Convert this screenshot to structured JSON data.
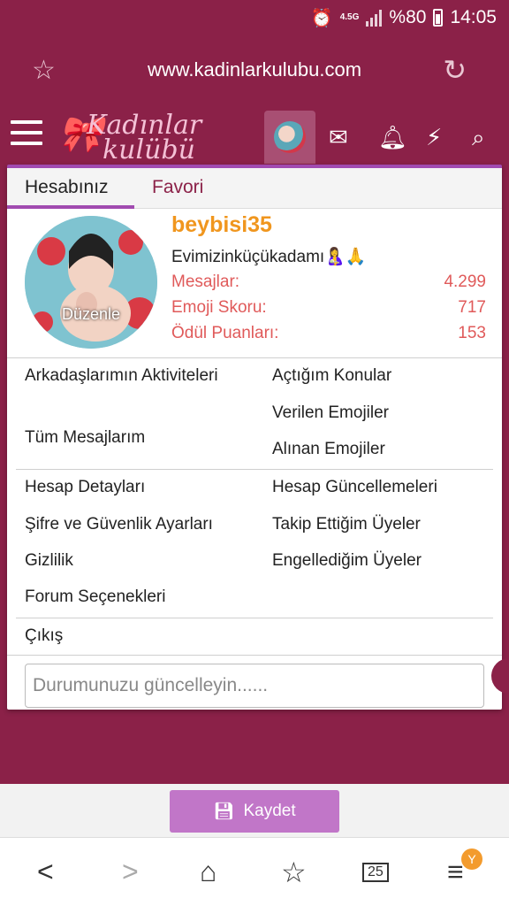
{
  "status_bar": {
    "battery": "%80",
    "time": "14:05",
    "network": "4.5G"
  },
  "browser": {
    "url": "www.kadinlarkulubu.com"
  },
  "site": {
    "logo_line1": "Kadınlar",
    "logo_line2": "kulübü"
  },
  "panel": {
    "tabs": [
      "Hesabınız",
      "Favori"
    ],
    "avatar_edit": "Düzenle",
    "username": "beybisi35",
    "user_title": "Evimizinküçükadamı🤱🙏",
    "stats": [
      {
        "label": "Mesajlar:",
        "value": "4.299"
      },
      {
        "label": "Emoji Skoru:",
        "value": "717"
      },
      {
        "label": "Ödül Puanları:",
        "value": "153"
      }
    ],
    "menu_col1": [
      "Arkadaşlarımın Aktiviteleri",
      "Tüm Mesajlarım"
    ],
    "menu_col2": [
      "Açtığım Konular",
      "Verilen Emojiler",
      "Alınan Emojiler"
    ],
    "menu2_col1": [
      "Hesap Detayları",
      "Şifre ve Güvenlik Ayarları",
      "Gizlilik",
      "Forum Seçenekleri"
    ],
    "menu2_col2": [
      "Hesap Güncellemeleri",
      "Takip Ettiğim Üyeler",
      "Engellediğim Üyeler"
    ],
    "logout": "Çıkış",
    "status_placeholder": "Durumunuzu güncelleyin......"
  },
  "save_button": "Kaydet",
  "bottom_nav": {
    "tabs_count": "25",
    "badge": "Y"
  },
  "colors": {
    "brand": "#8b2148",
    "accent": "#a14bb0",
    "username": "#f0961e",
    "stats": "#e05a5a"
  }
}
